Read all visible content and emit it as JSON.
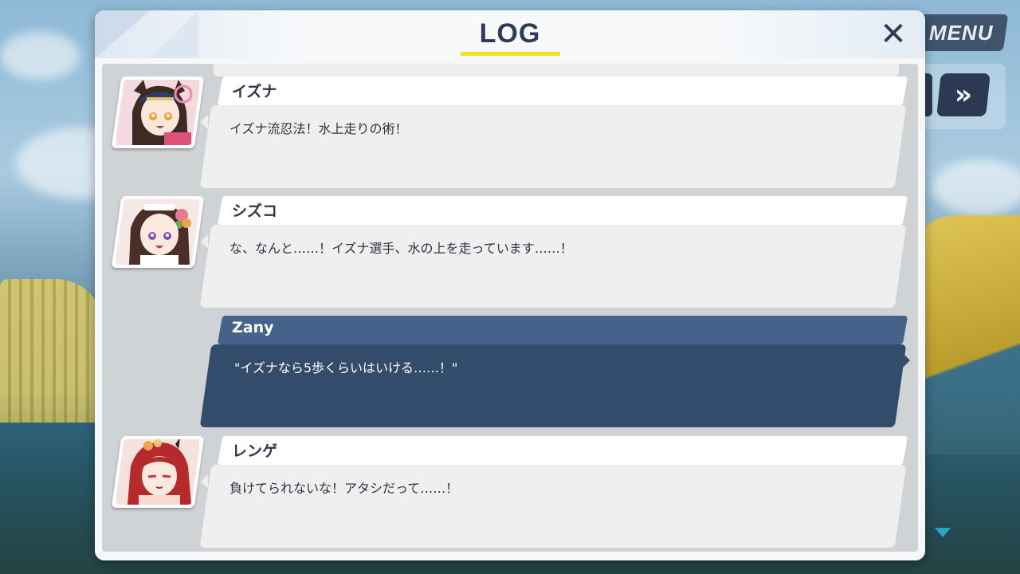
{
  "hud": {
    "menu_label": "MENU",
    "skip_label": "»"
  },
  "dialog": {
    "title": "LOG",
    "close_label": "✕"
  },
  "entries": [
    {
      "speaker": "イズナ",
      "text": "イズナ流忍法！水上走りの術！",
      "portrait": "izuna-portrait",
      "is_player": false
    },
    {
      "speaker": "シズコ",
      "text": "な、なんと……！イズナ選手、水の上を走っています……！",
      "portrait": "shizuko-portrait",
      "is_player": false
    },
    {
      "speaker": "Zany",
      "text": "\"イズナなら5歩くらいはいける……！\"",
      "portrait": null,
      "is_player": true
    },
    {
      "speaker": "レンゲ",
      "text": "負けてられないな！アタシだって……！",
      "portrait": "renge-portrait",
      "is_player": false
    }
  ],
  "colors": {
    "accent_underline": "#f2e21c",
    "title_text": "#2b3b58",
    "player_name_bar": "#44628a",
    "player_message_box": "#344c6b",
    "npc_message_box": "#efefef"
  }
}
